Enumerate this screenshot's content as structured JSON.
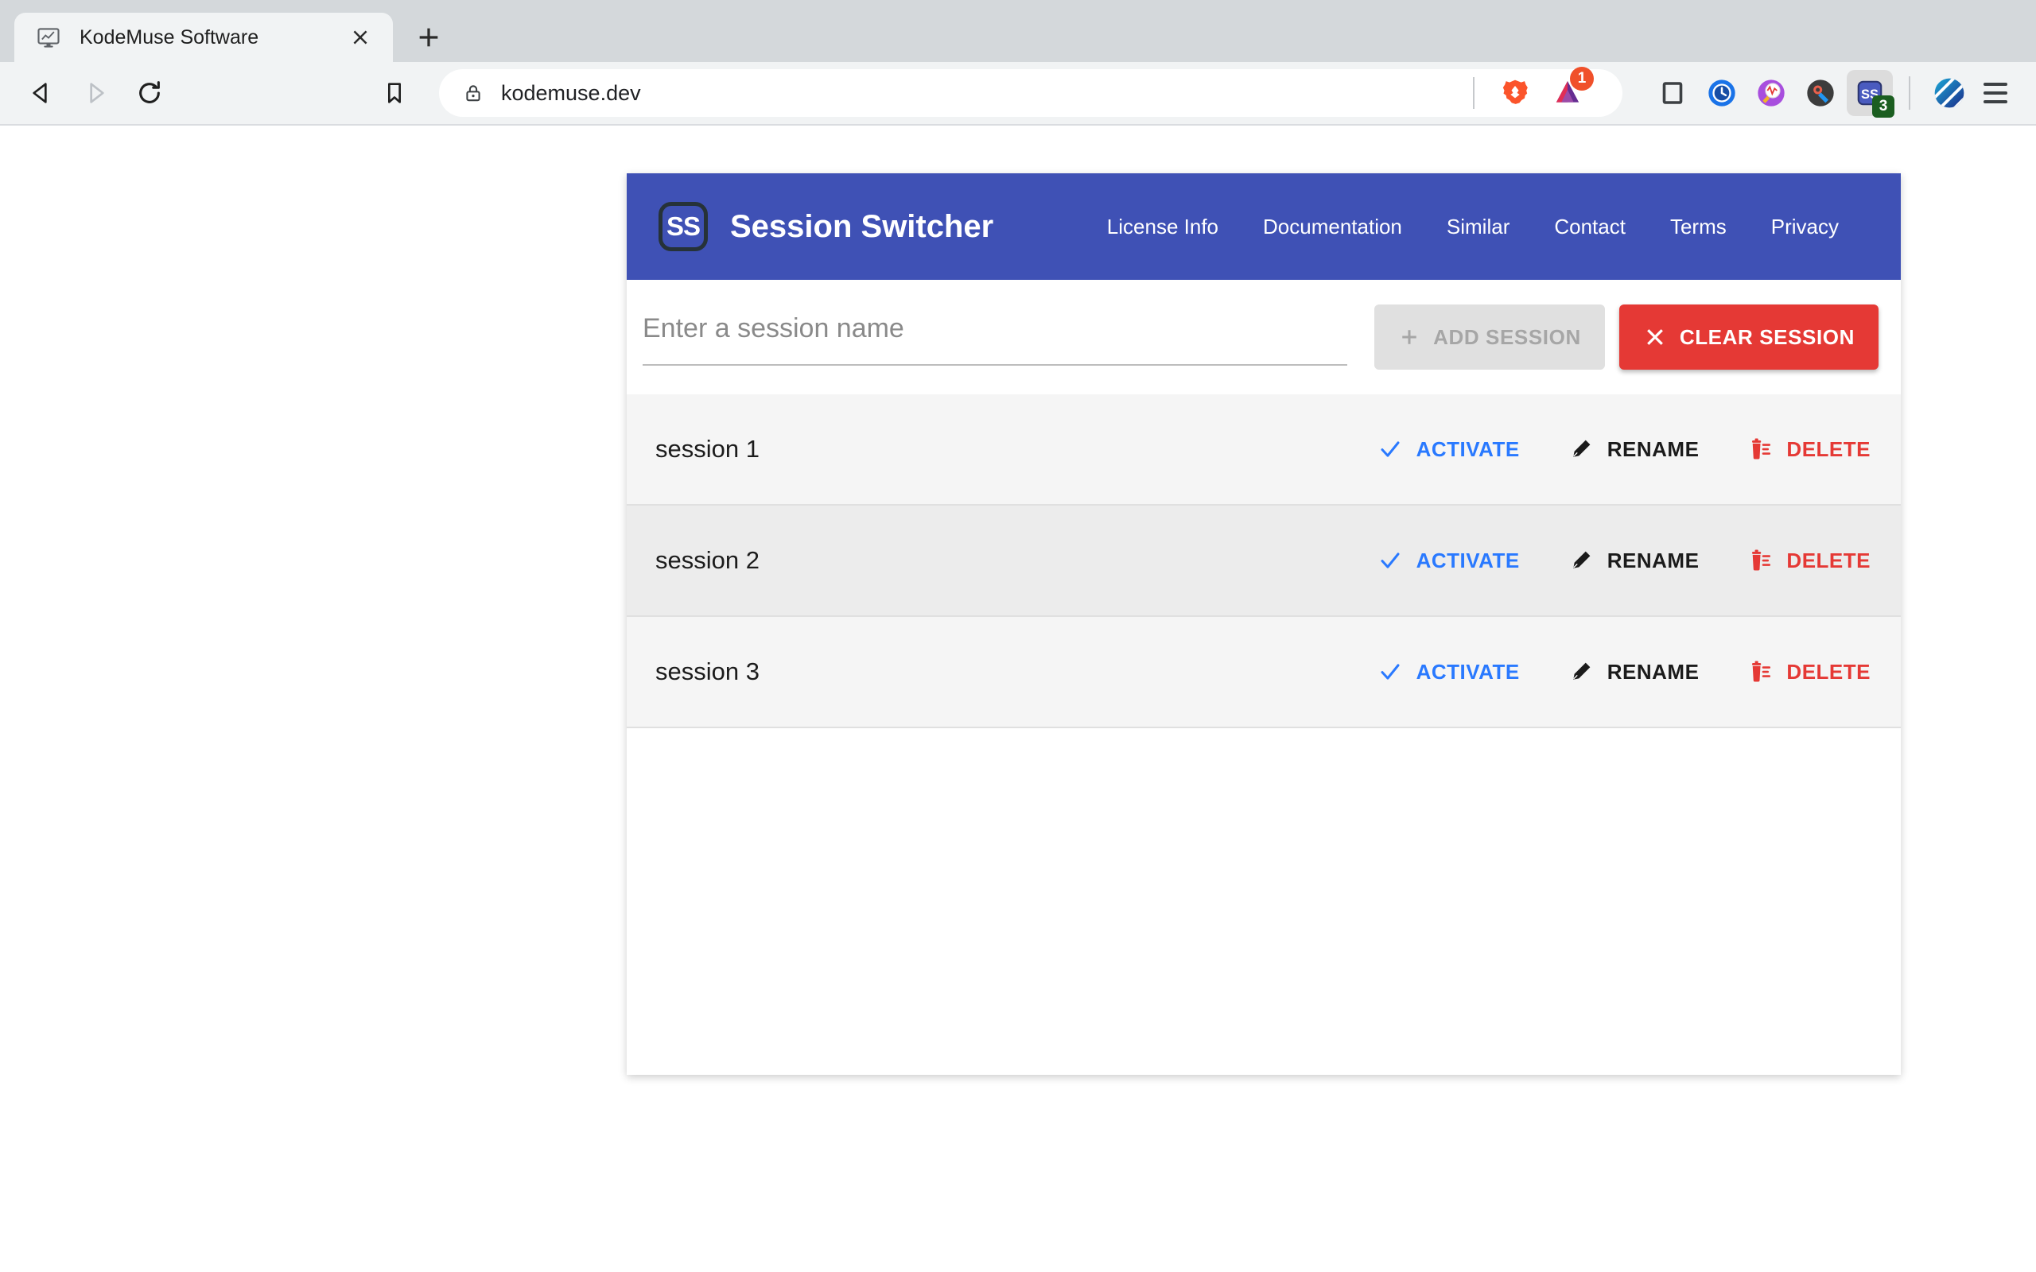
{
  "browser": {
    "tab": {
      "title": "KodeMuse Software",
      "favicon_icon": "monitor-chart-icon",
      "close_icon": "close-icon"
    },
    "new_tab_icon": "plus-icon",
    "back_icon": "back-arrow-icon",
    "forward_icon": "forward-arrow-icon",
    "reload_icon": "reload-icon",
    "bookmark_icon": "bookmark-icon",
    "omnibox": {
      "lock_icon": "lock-icon",
      "url": "kodemuse.dev"
    },
    "brave_shield_icon": "brave-lion-icon",
    "bat_rewards_icon": "bat-triangle-icon",
    "bat_badge": "1",
    "extensions": [
      {
        "icon": "square-outline-icon",
        "name": "square-extension"
      },
      {
        "icon": "clock-icon",
        "name": "clock-extension"
      },
      {
        "icon": "magnifier-pulse-icon",
        "name": "analyzer-extension"
      },
      {
        "icon": "wrench-icon",
        "name": "devtools-extension"
      },
      {
        "icon": "ss-extension-icon",
        "name": "session-switcher-extension",
        "badge": "3"
      }
    ],
    "profile_avatar_icon": "profile-avatar-icon",
    "menu_icon": "hamburger-menu-icon"
  },
  "app": {
    "brand": {
      "logo_text": "SS",
      "title": "Session Switcher"
    },
    "nav": [
      {
        "label": "License Info"
      },
      {
        "label": "Documentation"
      },
      {
        "label": "Similar"
      },
      {
        "label": "Contact"
      },
      {
        "label": "Terms"
      },
      {
        "label": "Privacy"
      }
    ],
    "controls": {
      "input_placeholder": "Enter a session name",
      "input_value": "",
      "add_button": {
        "label": "ADD SESSION",
        "icon": "plus-icon",
        "disabled": true
      },
      "clear_button": {
        "label": "CLEAR SESSION",
        "icon": "close-x-icon"
      }
    },
    "actions": {
      "activate_label": "ACTIVATE",
      "activate_icon": "check-icon",
      "rename_label": "RENAME",
      "rename_icon": "pencil-icon",
      "delete_label": "DELETE",
      "delete_icon": "trash-icon"
    },
    "sessions": [
      {
        "name": "session 1"
      },
      {
        "name": "session 2"
      },
      {
        "name": "session 3"
      }
    ]
  },
  "colors": {
    "header_blue": "#3f51b5",
    "activate_blue": "#2979ff",
    "delete_red": "#e53935",
    "clear_red": "#e53935",
    "row_odd": "#f5f5f5",
    "row_even": "#ececec",
    "badge_green": "#1b5e20"
  }
}
